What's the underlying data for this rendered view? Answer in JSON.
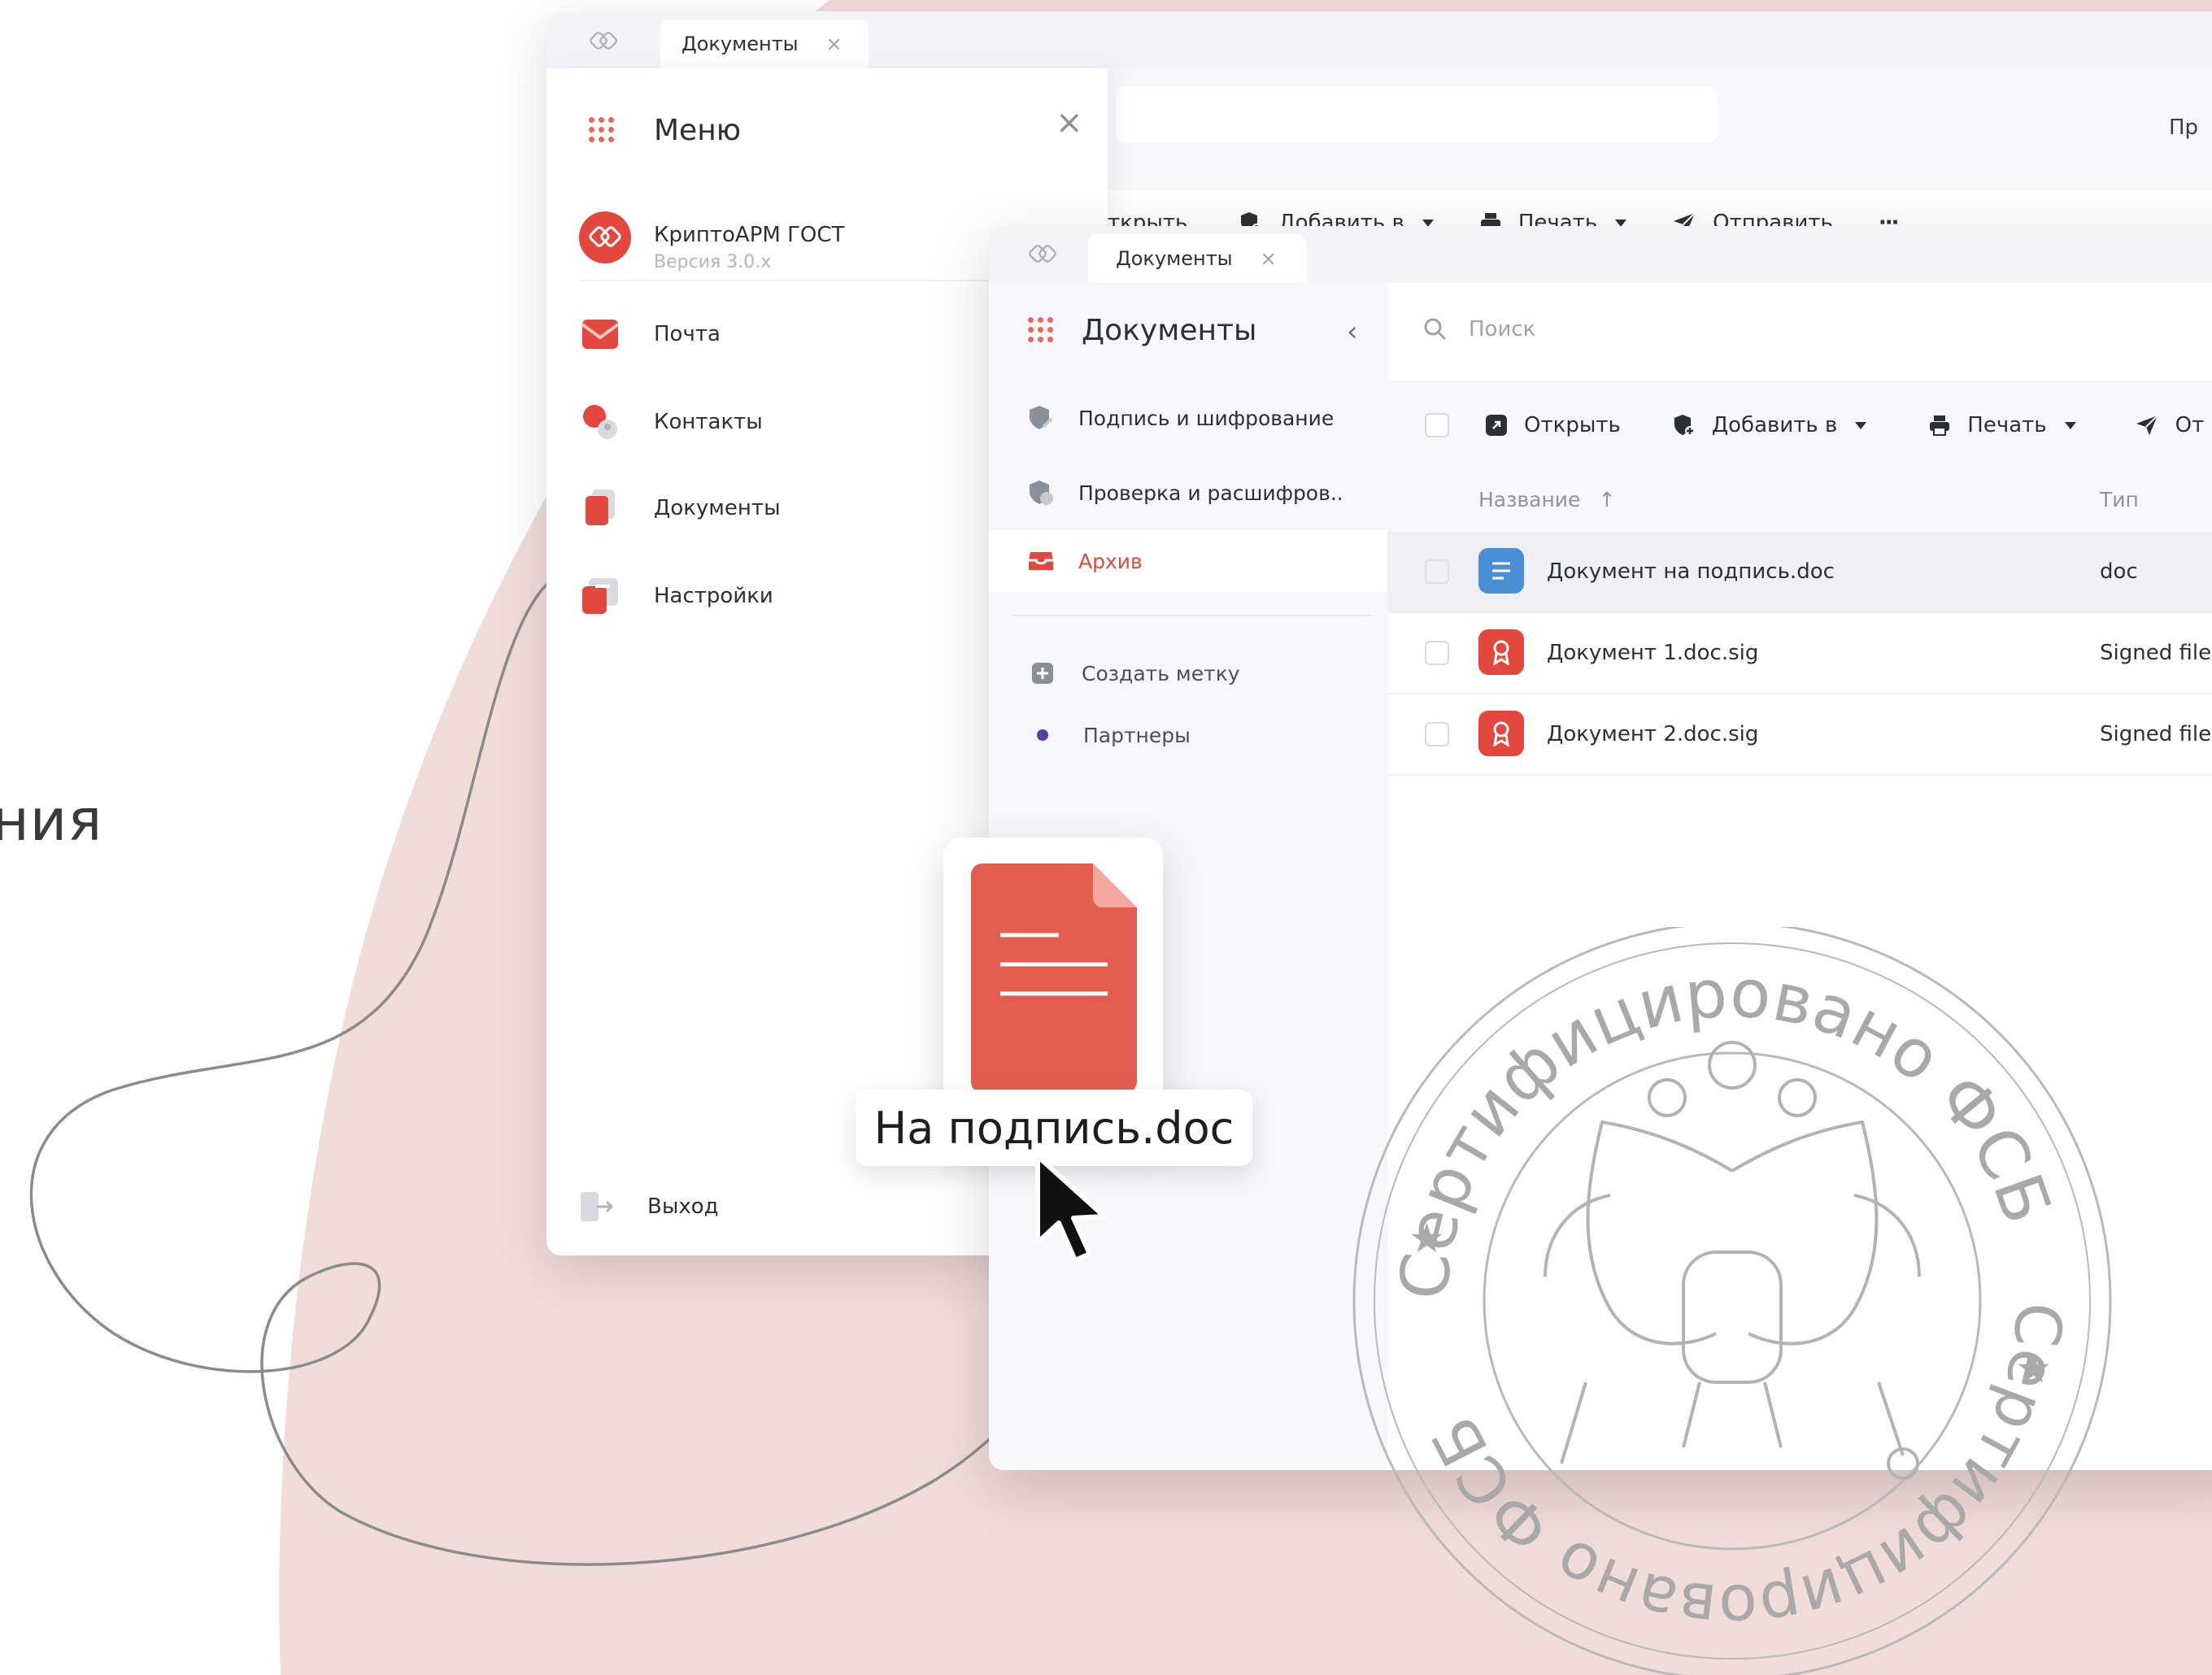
{
  "side_text": "ния",
  "back_window": {
    "tab_label": "Документы",
    "tab_close": "×",
    "menu": {
      "title": "Меню",
      "close": "×",
      "app": {
        "name": "КриптоАРМ ГОСТ",
        "version": "Версия 3.0.x"
      },
      "items": [
        "Почта",
        "Контакты",
        "Документы",
        "Настройки"
      ],
      "exit": "Выход"
    },
    "top_right_text": "Пр",
    "toolbar": {
      "open": "ткрыть",
      "add_to": "Добавить в",
      "print": "Печать",
      "send": "Отправить",
      "more": "···"
    }
  },
  "front_window": {
    "tab_label": "Документы",
    "tab_close": "×",
    "sidebar": {
      "title": "Документы",
      "collapse": "‹",
      "items": [
        "Подпись и шифрование",
        "Проверка и расшифров..",
        "Архив"
      ],
      "active_item": "Архив",
      "labels": [
        "Создать метку",
        "Партнеры"
      ]
    },
    "search": {
      "placeholder": "Поиск"
    },
    "toolbar": {
      "open": "Открыть",
      "add_to": "Добавить в",
      "print": "Печать",
      "send": "От"
    },
    "table": {
      "columns": [
        "Название",
        "Тип"
      ],
      "sort_arrow": "↑",
      "rows": [
        {
          "name": "Документ на подпись.doc",
          "type": "doc",
          "icon": "doc-file-icon"
        },
        {
          "name": "Документ 1.doc.sig",
          "type": "Signed file",
          "icon": "signed-file-icon"
        },
        {
          "name": "Документ 2.doc.sig",
          "type": "Signed file",
          "icon": "signed-file-icon"
        }
      ]
    }
  },
  "drag_file": {
    "label": "На подпись.doc"
  },
  "stamp": {
    "top_text": "Сертифицировано ФСБ",
    "bottom_text": "Сертифицировано ФСБ",
    "stars": "★"
  },
  "colors": {
    "accent": "#e2483d",
    "doc_blue": "#4a8fd6",
    "background_blob": "#f0dcd9",
    "file_red": "#e25d4f"
  }
}
